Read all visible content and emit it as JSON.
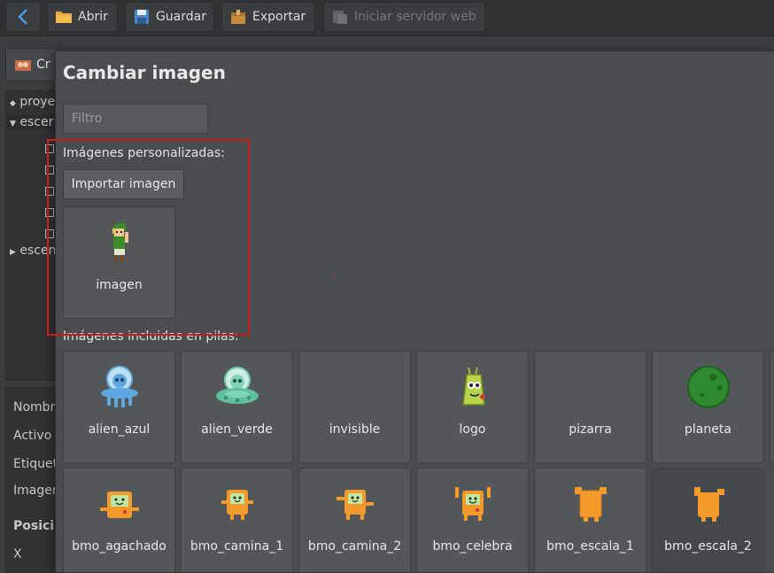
{
  "toolbar": {
    "back_icon": "arrow-left-icon",
    "abrir_label": "Abrir",
    "guardar_label": "Guardar",
    "exportar_label": "Exportar",
    "servidor_label": "Iniciar servidor web"
  },
  "left_panel": {
    "crear_label": "Cr",
    "tree": [
      "proye",
      "escer",
      "escen"
    ],
    "props": [
      "Nombr",
      "Activo",
      "Etiquet",
      "Imagen",
      "Posici",
      "X"
    ]
  },
  "modal": {
    "title": "Cambiar imagen",
    "filter_placeholder": "Filtro",
    "custom_section_label": "Imágenes personalizadas:",
    "import_button_label": "Importar imagen",
    "custom_images": [
      {
        "name": "imagen",
        "icon": "link-character-sprite"
      }
    ],
    "included_section_label": "Imágenes incluidas en pilas:",
    "included_images": [
      {
        "name": "alien_azul",
        "icon": "blue-alien-sprite"
      },
      {
        "name": "alien_verde",
        "icon": "green-alien-sprite"
      },
      {
        "name": "invisible",
        "icon": ""
      },
      {
        "name": "logo",
        "icon": "logo-sprite"
      },
      {
        "name": "pizarra",
        "icon": ""
      },
      {
        "name": "planeta",
        "icon": "planet-sprite"
      },
      {
        "name": "bmo_agachado",
        "icon": "bmo-sprite"
      },
      {
        "name": "bmo_camina_1",
        "icon": "bmo-sprite"
      },
      {
        "name": "bmo_camina_2",
        "icon": "bmo-sprite"
      },
      {
        "name": "bmo_celebra",
        "icon": "bmo-sprite"
      },
      {
        "name": "bmo_escala_1",
        "icon": "bmo-sprite"
      },
      {
        "name": "bmo_escala_2",
        "icon": "bmo-sprite"
      }
    ]
  },
  "colors": {
    "background": "#3c3f41",
    "modal": "#4a4d50",
    "tile": "#545759",
    "highlight": "#cc1a1a",
    "accent_blue": "#4a9fe0",
    "bmo_orange": "#f39a2b"
  }
}
